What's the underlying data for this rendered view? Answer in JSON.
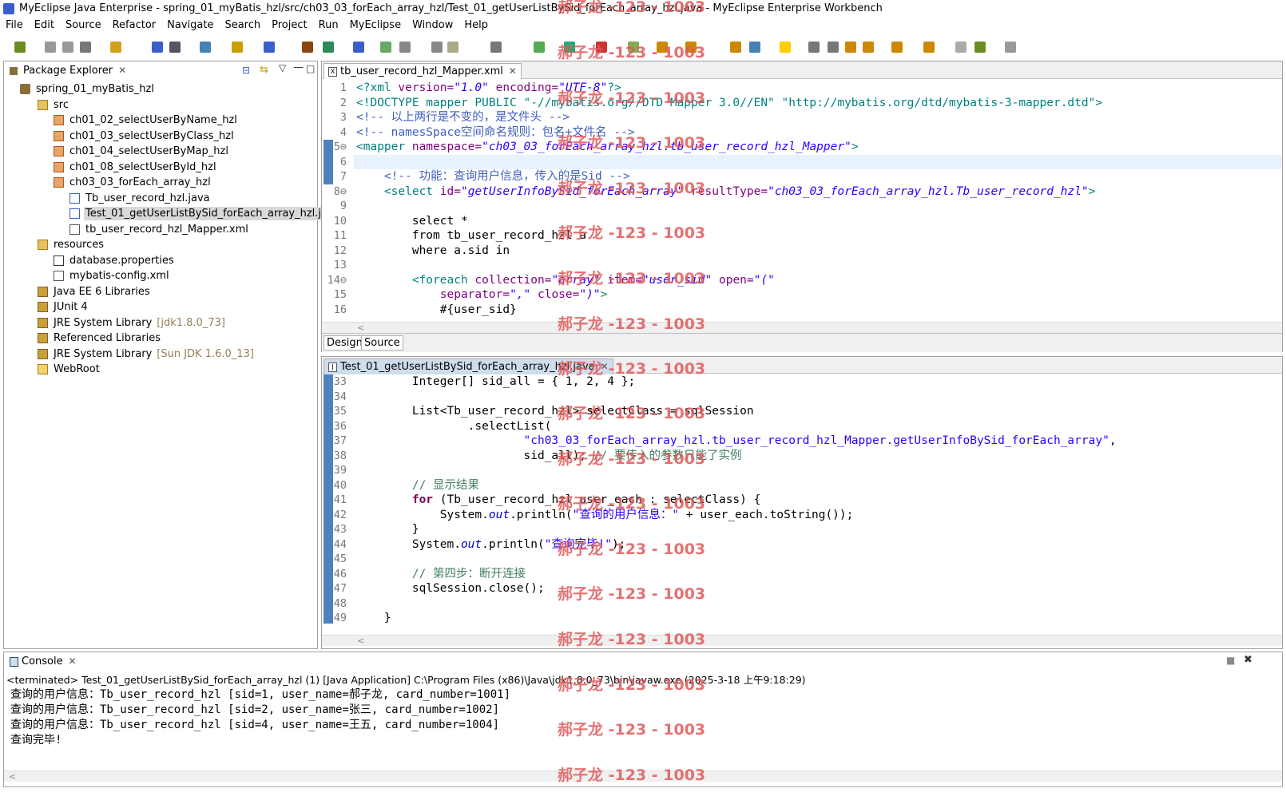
{
  "window": {
    "title": "MyEclipse Java Enterprise - spring_01_myBatis_hzl/src/ch03_03_forEach_array_hzl/Test_01_getUserListBySid_forEach_array_hzl.java - MyEclipse Enterprise Workbench"
  },
  "menu": [
    "File",
    "Edit",
    "Source",
    "Refactor",
    "Navigate",
    "Search",
    "Project",
    "Run",
    "MyEclipse",
    "Window",
    "Help"
  ],
  "explorer": {
    "title": "Package Explorer",
    "items": [
      {
        "label": "spring_01_myBatis_hzl",
        "icon": "project-icon",
        "indent": 0,
        "suffix": ""
      },
      {
        "label": "src",
        "icon": "source-folder-icon",
        "indent": 1,
        "suffix": ""
      },
      {
        "label": "ch01_02_selectUserByName_hzl",
        "icon": "package-icon",
        "indent": 2,
        "suffix": ""
      },
      {
        "label": "ch01_03_selectUserByClass_hzl",
        "icon": "package-icon",
        "indent": 2,
        "suffix": ""
      },
      {
        "label": "ch01_04_selectUserByMap_hzl",
        "icon": "package-icon",
        "indent": 2,
        "suffix": ""
      },
      {
        "label": "ch01_08_selectUserById_hzl",
        "icon": "package-icon",
        "indent": 2,
        "suffix": ""
      },
      {
        "label": "ch03_03_forEach_array_hzl",
        "icon": "package-icon",
        "indent": 2,
        "suffix": ""
      },
      {
        "label": "Tb_user_record_hzl.java",
        "icon": "java-file-icon",
        "indent": 3,
        "suffix": ""
      },
      {
        "label": "Test_01_getUserListBySid_forEach_array_hzl.java",
        "icon": "java-file-icon",
        "indent": 3,
        "suffix": "",
        "selected": true
      },
      {
        "label": "tb_user_record_hzl_Mapper.xml",
        "icon": "xml-file-icon",
        "indent": 3,
        "suffix": ""
      },
      {
        "label": "resources",
        "icon": "source-folder-icon",
        "indent": 1,
        "suffix": ""
      },
      {
        "label": "database.properties",
        "icon": "properties-file-icon",
        "indent": 2,
        "suffix": ""
      },
      {
        "label": "mybatis-config.xml",
        "icon": "xml-file-icon",
        "indent": 2,
        "suffix": ""
      },
      {
        "label": "Java EE 6 Libraries",
        "icon": "library-icon",
        "indent": 1,
        "suffix": ""
      },
      {
        "label": "JUnit 4",
        "icon": "library-icon",
        "indent": 1,
        "suffix": ""
      },
      {
        "label": "JRE System Library",
        "icon": "library-icon",
        "indent": 1,
        "suffix": "[jdk1.8.0_73]"
      },
      {
        "label": "Referenced Libraries",
        "icon": "library-icon",
        "indent": 1,
        "suffix": ""
      },
      {
        "label": "JRE System Library",
        "icon": "library-icon",
        "indent": 1,
        "suffix": "[Sun JDK 1.6.0_13]"
      },
      {
        "label": "WebRoot",
        "icon": "folder-icon",
        "indent": 1,
        "suffix": ""
      }
    ]
  },
  "xml_editor": {
    "tab": "tb_user_record_hzl_Mapper.xml",
    "bottom_tabs": [
      "Design",
      "Source"
    ],
    "lines": [
      {
        "n": "1",
        "segs": [
          [
            "<?xml ",
            "t"
          ],
          [
            "version=",
            "a"
          ],
          [
            "\"1.0\"",
            "v"
          ],
          [
            " encoding=",
            "a"
          ],
          [
            "\"UTF-8\"",
            "v"
          ],
          [
            "?>",
            "t"
          ]
        ]
      },
      {
        "n": "2",
        "segs": [
          [
            "<!DOCTYPE mapper PUBLIC \"-//mybatis.org//DTD Mapper 3.0//EN\" \"http://mybatis.org/dtd/mybatis-3-mapper.dtd\">",
            "t"
          ]
        ]
      },
      {
        "n": "3",
        "segs": [
          [
            "<!-- 以上两行是不变的，是文件头 -->",
            "c"
          ]
        ]
      },
      {
        "n": "4",
        "segs": [
          [
            "<!-- namesSpace空间命名规则：包名+文件名 -->",
            "c"
          ]
        ]
      },
      {
        "n": "5",
        "fold": true,
        "segs": [
          [
            "<mapper ",
            "t"
          ],
          [
            "namespace=",
            "a"
          ],
          [
            "\"ch03_03_forEach_array_hzl.tb_user_record_hzl_Mapper\"",
            "v"
          ],
          [
            ">",
            "t"
          ]
        ]
      },
      {
        "n": "6",
        "segs": [
          [
            "",
            "t"
          ]
        ],
        "highlight": true
      },
      {
        "n": "7",
        "segs": [
          [
            "    <!-- 功能：查询用户信息，传入的是Sid -->",
            "c"
          ]
        ]
      },
      {
        "n": "8",
        "fold": true,
        "segs": [
          [
            "    <select ",
            "t"
          ],
          [
            "id=",
            "a"
          ],
          [
            "\"getUserInfoBySid_forEach_array\"",
            "v"
          ],
          [
            " resultType=",
            "a"
          ],
          [
            "\"ch03_03_forEach_array_hzl.Tb_user_record_hzl\"",
            "v"
          ],
          [
            ">",
            "t"
          ]
        ]
      },
      {
        "n": "9",
        "segs": [
          [
            "",
            "t"
          ]
        ]
      },
      {
        "n": "10",
        "segs": [
          [
            "        select *",
            "k"
          ]
        ]
      },
      {
        "n": "11",
        "segs": [
          [
            "        from tb_user_record_hzl a",
            "k"
          ]
        ]
      },
      {
        "n": "12",
        "segs": [
          [
            "        where a.sid in",
            "k"
          ]
        ]
      },
      {
        "n": "13",
        "segs": [
          [
            "",
            "t"
          ]
        ]
      },
      {
        "n": "14",
        "fold": true,
        "segs": [
          [
            "        <foreach ",
            "t"
          ],
          [
            "collection=",
            "a"
          ],
          [
            "\"array\"",
            "v"
          ],
          [
            " item=",
            "a"
          ],
          [
            "\"user_sid\"",
            "v"
          ],
          [
            " open=",
            "a"
          ],
          [
            "\"(\"",
            "v"
          ]
        ]
      },
      {
        "n": "15",
        "segs": [
          [
            "            separator=",
            "a"
          ],
          [
            "\",\"",
            "v"
          ],
          [
            " close=",
            "a"
          ],
          [
            "\")\"",
            "v"
          ],
          [
            ">",
            "t"
          ]
        ]
      },
      {
        "n": "16",
        "segs": [
          [
            "            #{user_sid}",
            "k"
          ]
        ]
      }
    ]
  },
  "java_editor": {
    "tab": "Test_01_getUserListBySid_forEach_array_hzl.java",
    "lines": [
      {
        "n": "33",
        "segs": [
          [
            "        Integer[] sid_all = { 1, 2, 4 };",
            "k"
          ]
        ]
      },
      {
        "n": "34",
        "segs": [
          [
            "",
            "k"
          ]
        ]
      },
      {
        "n": "35",
        "segs": [
          [
            "        List<Tb_user_record_hzl> selectClass = sqlSession",
            "k"
          ]
        ]
      },
      {
        "n": "36",
        "segs": [
          [
            "                .selectList(",
            "k"
          ]
        ]
      },
      {
        "n": "37",
        "segs": [
          [
            "                        ",
            "k"
          ],
          [
            "\"ch03_03_forEach_array_hzl.tb_user_record_hzl_Mapper.getUserInfoBySid_forEach_array\"",
            "s"
          ],
          [
            ",",
            "k"
          ]
        ]
      },
      {
        "n": "38",
        "segs": [
          [
            "                        sid_all); ",
            "k"
          ],
          [
            "// 要传入的参数只能了实例",
            "g"
          ]
        ]
      },
      {
        "n": "39",
        "segs": [
          [
            "",
            "k"
          ]
        ]
      },
      {
        "n": "40",
        "segs": [
          [
            "        ",
            "k"
          ],
          [
            "// 显示结果",
            "g"
          ]
        ]
      },
      {
        "n": "41",
        "segs": [
          [
            "        ",
            "k"
          ],
          [
            "for",
            "kw"
          ],
          [
            " (Tb_user_record_hzl user_each : selectClass) {",
            "k"
          ]
        ]
      },
      {
        "n": "42",
        "segs": [
          [
            "            System.",
            "k"
          ],
          [
            "out",
            "f"
          ],
          [
            ".println(",
            "k"
          ],
          [
            "\"查询的用户信息：\"",
            "s"
          ],
          [
            " + user_each.toString());",
            "k"
          ]
        ]
      },
      {
        "n": "43",
        "segs": [
          [
            "        }",
            "k"
          ]
        ]
      },
      {
        "n": "44",
        "segs": [
          [
            "        System.",
            "k"
          ],
          [
            "out",
            "f"
          ],
          [
            ".println(",
            "k"
          ],
          [
            "\"查询完毕!\"",
            "s"
          ],
          [
            ");",
            "k"
          ]
        ]
      },
      {
        "n": "45",
        "segs": [
          [
            "",
            "k"
          ]
        ]
      },
      {
        "n": "46",
        "segs": [
          [
            "        ",
            "k"
          ],
          [
            "// 第四步：断开连接",
            "g"
          ]
        ]
      },
      {
        "n": "47",
        "segs": [
          [
            "        sqlSession.close();",
            "k"
          ]
        ]
      },
      {
        "n": "48",
        "segs": [
          [
            "",
            "k"
          ]
        ]
      },
      {
        "n": "49",
        "segs": [
          [
            "    }",
            "k"
          ]
        ]
      }
    ]
  },
  "console": {
    "title": "Console",
    "header": "<terminated> Test_01_getUserListBySid_forEach_array_hzl (1) [Java Application] C:\\Program Files (x86)\\Java\\jdk1.8.0_73\\bin\\javaw.exe (2025-3-18 上午9:18:29)",
    "lines": [
      "查询的用户信息：Tb_user_record_hzl [sid=1, user_name=郝子龙, card_number=1001]",
      "查询的用户信息：Tb_user_record_hzl [sid=2, user_name=张三, card_number=1002]",
      "查询的用户信息：Tb_user_record_hzl [sid=4, user_name=王五, card_number=1004]",
      "查询完毕!"
    ]
  },
  "watermark": "郝子龙 -123 - 1003",
  "colors": {
    "xml_tag": "#008080",
    "xml_attr": "#7f007f",
    "xml_value": "#2a00ff",
    "xml_comment": "#3f5fbf",
    "java_keyword": "#7f0055",
    "java_string": "#2a00ff",
    "java_comment": "#3f7f5f",
    "java_field": "#0000c0",
    "gutter": "#4f81bd",
    "selected_bg": "#d9d9d9",
    "line_highlight": "#e8f2fe",
    "library_suffix": "#95805a"
  }
}
